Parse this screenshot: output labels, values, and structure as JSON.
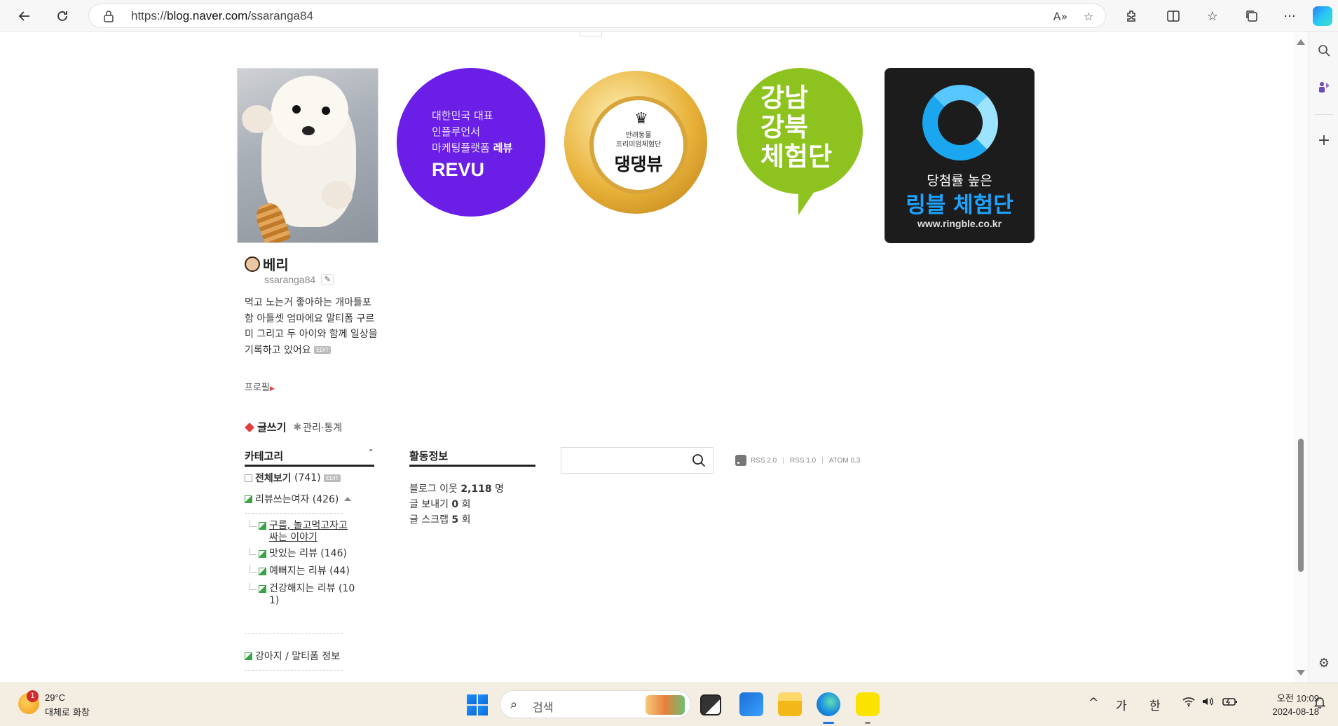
{
  "browser": {
    "url_prefix": "https://",
    "url_domain": "blog.naver.com",
    "url_path": "/ssaranga84",
    "read_aloud": "A»"
  },
  "banners": {
    "revu": {
      "line1": "대한민국 대표",
      "line2": "인플루언서",
      "line3a": "마케팅플랫폼 ",
      "line3b": "레뷰",
      "logo": "REVU"
    },
    "medal": {
      "small1": "반려동물",
      "small2": "프리미엄체험단",
      "title": "댕댕뷰"
    },
    "green": {
      "line1": "강남",
      "line2": "강북",
      "line3": "체험단"
    },
    "ringble": {
      "line1": "당첨률 높은",
      "line2": "링블 체험단",
      "line3": "www.ringble.co.kr"
    }
  },
  "profile": {
    "nickname": "베리",
    "blog_id": "ssaranga84",
    "intro": "먹고 노는거 좋아하는 개아들포함 아들셋 엄마에요 말티폼 구르미 그리고 두 아이와 함께  일상을 기록하고 있어요",
    "edit_badge": "EDIT",
    "profile_link": "프로필",
    "write": "글쓰기",
    "manage": "관리·통계"
  },
  "category": {
    "title": "카테고리",
    "all_label": "전체보기",
    "all_count": "(741)",
    "all_badge": "EDIT",
    "items": [
      {
        "label": "리뷰쓰는여자 (426)"
      },
      {
        "label": "구름, 놀고먹고자고"
      },
      {
        "label": "싸는 이야기"
      },
      {
        "label": "맛있는 리뷰 (146)"
      },
      {
        "label": "예뻐지는 리뷰 (44)"
      },
      {
        "label": "건강해지는 리뷰 (10"
      },
      {
        "label": "1)"
      },
      {
        "label": "강아지 / 말티폼 정보"
      }
    ]
  },
  "activity": {
    "title": "활동정보",
    "neighbors_label": "블로그 이웃 ",
    "neighbors_value": "2,118",
    "neighbors_unit": " 명",
    "send_label": "글 보내기 ",
    "send_value": "0",
    "send_unit": " 회",
    "scrap_label": "글 스크랩 ",
    "scrap_value": "5",
    "scrap_unit": " 회"
  },
  "search": {
    "placeholder": ""
  },
  "rss": {
    "rss2": "RSS 2.0",
    "rss1": "RSS 1.0",
    "atom": "ATOM 0.3",
    "sep": "|"
  },
  "taskbar": {
    "weather_temp": "29°C",
    "weather_desc": "대체로 화창",
    "weather_badge": "1",
    "search_placeholder": "검색",
    "tray_chevron": "^",
    "ime1": "가",
    "ime2": "한",
    "time": "오전 10:09",
    "date": "2024-08-18"
  }
}
